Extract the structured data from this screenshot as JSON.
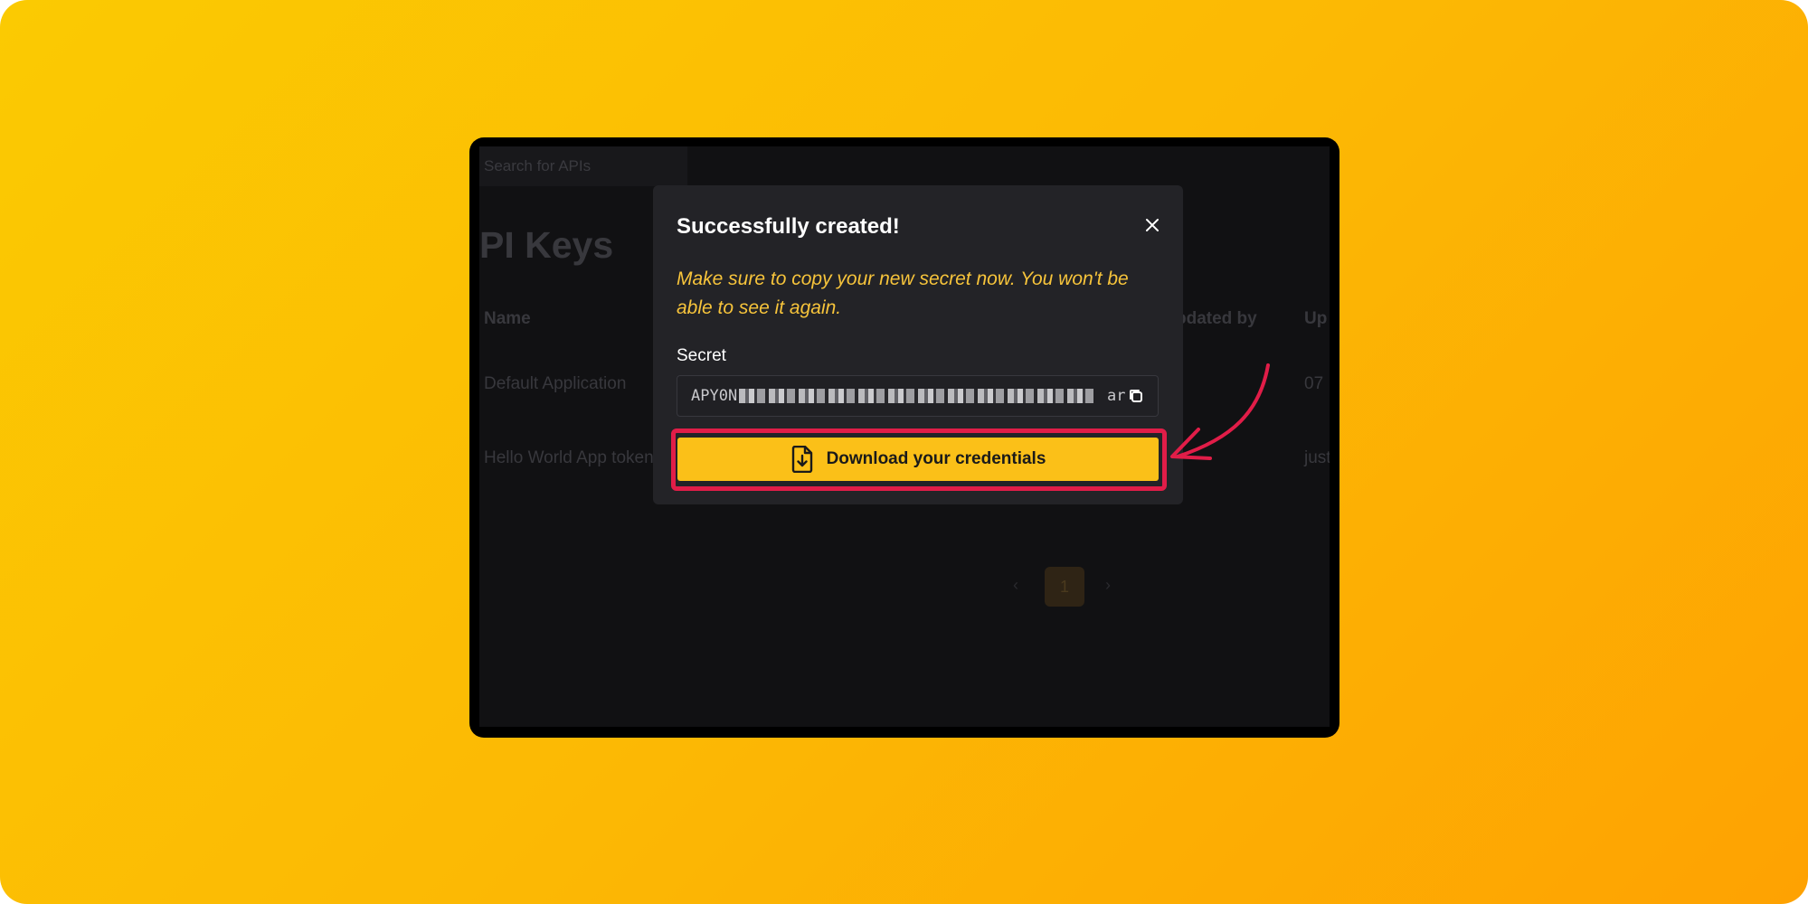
{
  "colors": {
    "background_gradient": [
      "#fbca02",
      "#fea202"
    ],
    "modal_bg": "#232327",
    "warning_text": "#f7c43b",
    "primary_button": "#fbc018",
    "highlight": "#e11d48"
  },
  "page": {
    "search_placeholder": "Search for APIs",
    "title": "PI Keys",
    "columns": [
      "Name",
      "pdated by",
      "Up"
    ],
    "rows": [
      {
        "name": "Default Application",
        "updated": "07"
      },
      {
        "name": "Hello World App token",
        "updated": "just"
      }
    ],
    "pagination": {
      "prev": "‹",
      "current": "1",
      "next": "›"
    }
  },
  "modal": {
    "title": "Successfully created!",
    "warning": "Make sure to copy your new secret now. You won't be able to see it again.",
    "secret_label": "Secret",
    "secret_prefix": "APY0N",
    "secret_suffix": "ar",
    "copy_icon": "copy-icon",
    "close_icon": "close-icon",
    "download_icon": "file-download-icon",
    "download_label": "Download your credentials"
  },
  "annotation": {
    "arrow": "curved-arrow-pointer",
    "highlight": "red-highlight-box"
  }
}
